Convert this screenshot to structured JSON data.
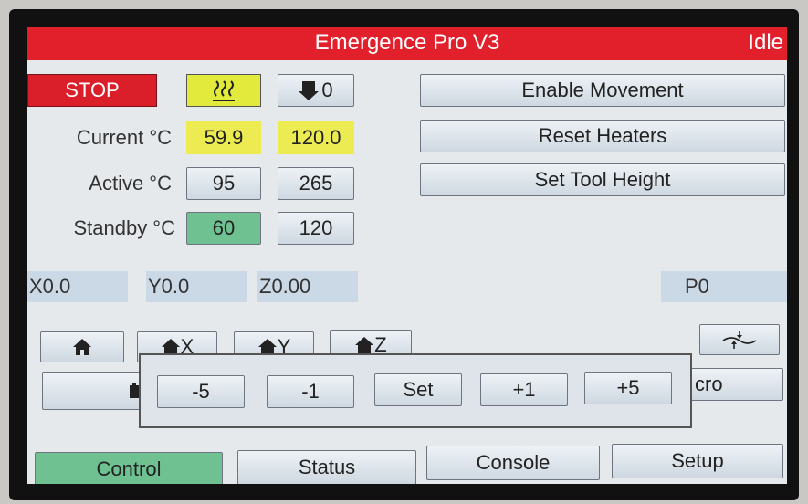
{
  "header": {
    "title": "Emergence Pro V3",
    "status": "Idle"
  },
  "toolbar": {
    "stop_label": "STOP",
    "fan_value": "0"
  },
  "temps": {
    "current_label": "Current °C",
    "active_label": "Active °C",
    "standby_label": "Standby °C",
    "current": [
      "59.9",
      "120.0"
    ],
    "active": [
      "95",
      "265"
    ],
    "standby": [
      "60",
      "120"
    ]
  },
  "actions": {
    "enable_movement": "Enable Movement",
    "reset_heaters": "Reset Heaters",
    "set_tool_height": "Set Tool Height"
  },
  "position": {
    "x": "X0.0",
    "y": "Y0.0",
    "z": "Z0.00",
    "p": "P0"
  },
  "homing": {
    "x_label": "X",
    "y_label": "Y",
    "z_label": "Z"
  },
  "macro_fragment": "cro",
  "popup": {
    "buttons": [
      "-5",
      "-1",
      "Set",
      "+1",
      "+5"
    ]
  },
  "tabs": [
    "Control",
    "Status",
    "Console",
    "Setup"
  ],
  "colors": {
    "title_bar": "#e1202c",
    "highlight_yellow": "#ecec52",
    "selected_green": "#6fc192",
    "position_bg": "#cbd8e6"
  },
  "icons": [
    "heater-icon",
    "fan-icon",
    "home-icon",
    "bed-compensation-icon",
    "macro-icon"
  ]
}
